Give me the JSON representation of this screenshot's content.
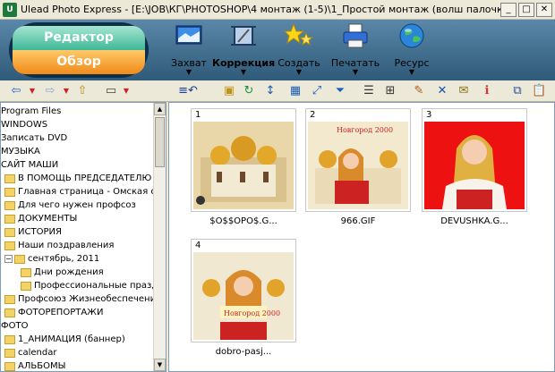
{
  "window": {
    "title": "Ulead Photo Express - [E:\\JOB\\КГ\\PHOTOSHOP\\4 монтаж (1-5)\\1_Простой монтаж (волш палочка)\\Примеры\\Прос...",
    "buttons": [
      "_",
      "□",
      "✕"
    ]
  },
  "mode": {
    "editor": "Редактор",
    "browse": "Обзор"
  },
  "tools": [
    {
      "label": "Захват",
      "icon": "capture-icon"
    },
    {
      "label": "Коррекция",
      "icon": "crop-icon"
    },
    {
      "label": "Создать",
      "icon": "stars-icon"
    },
    {
      "label": "Печатать",
      "icon": "printer-icon"
    },
    {
      "label": "Ресурс",
      "icon": "globe-icon"
    }
  ],
  "tree": [
    {
      "label": "Program Files",
      "indent": 0,
      "folder": false
    },
    {
      "label": "WINDOWS",
      "indent": 0,
      "folder": false
    },
    {
      "label": "Записать DVD",
      "indent": 0,
      "folder": false
    },
    {
      "label": "МУЗЫКА",
      "indent": 0,
      "folder": false
    },
    {
      "label": "САЙТ МАШИ",
      "indent": 0,
      "folder": false
    },
    {
      "label": "В ПОМОЩЬ ПРЕДСЕДАТЕЛЮ",
      "indent": 1,
      "folder": true
    },
    {
      "label": "Главная страница - Омская обла",
      "indent": 1,
      "folder": true
    },
    {
      "label": "Для чего нужен профсоз",
      "indent": 1,
      "folder": true
    },
    {
      "label": "ДОКУМЕНТЫ",
      "indent": 1,
      "folder": true
    },
    {
      "label": "ИСТОРИЯ",
      "indent": 1,
      "folder": true
    },
    {
      "label": "Наши поздравления",
      "indent": 1,
      "folder": true
    },
    {
      "label": "сентябрь, 2011",
      "indent": 1,
      "folder": true,
      "expanded": true
    },
    {
      "label": "Дни рождения",
      "indent": 2,
      "folder": true
    },
    {
      "label": "Профессиональные празд",
      "indent": 2,
      "folder": true
    },
    {
      "label": "Профсоюз Жизнеобеспечения - _",
      "indent": 1,
      "folder": true
    },
    {
      "label": "ФОТОРЕПОРТАЖИ",
      "indent": 1,
      "folder": true
    },
    {
      "label": "ФОТО",
      "indent": 0,
      "folder": false
    },
    {
      "label": "1_АНИМАЦИЯ (баннер)",
      "indent": 1,
      "folder": true
    },
    {
      "label": "calendar",
      "indent": 1,
      "folder": true
    },
    {
      "label": "АЛЬБОМЫ",
      "indent": 1,
      "folder": true
    }
  ],
  "thumbnails": [
    {
      "number": "1",
      "caption": "$O$$OPO$.G...",
      "bg": "#e9d7a9",
      "overlay": ""
    },
    {
      "number": "2",
      "caption": "966.GIF",
      "bg": "#f3e9cf",
      "overlay": "Новгород 2000"
    },
    {
      "number": "3",
      "caption": "DEVUSHKA.G...",
      "bg": "#ee1111",
      "overlay": ""
    },
    {
      "number": "4",
      "caption": "dobro-pasj...",
      "bg": "#f1e8d2",
      "overlay": "Новгород 2000"
    }
  ],
  "colors": {
    "header_top": "#5b88a8",
    "header_bottom": "#2f5a7a",
    "editor": "#3fb896",
    "browse": "#f08a18"
  }
}
